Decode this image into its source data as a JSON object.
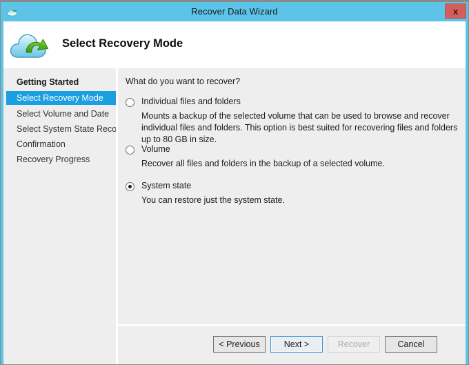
{
  "window": {
    "title": "Recover Data Wizard",
    "title_icon": "cloud-icon",
    "close_label": "x",
    "accent_color": "#5bc4e8",
    "close_color": "#d35f5c"
  },
  "header": {
    "icon": "cloud-recovery-icon",
    "page_title": "Select Recovery Mode"
  },
  "sidebar": {
    "items": [
      {
        "label": "Getting Started",
        "state": "completed"
      },
      {
        "label": "Select Recovery Mode",
        "state": "active"
      },
      {
        "label": "Select Volume and Date",
        "state": "pending"
      },
      {
        "label": "Select System State Reco...",
        "state": "pending"
      },
      {
        "label": "Confirmation",
        "state": "pending"
      },
      {
        "label": "Recovery Progress",
        "state": "pending"
      }
    ],
    "active_color": "#1a9fe0"
  },
  "main": {
    "question": "What do you want to recover?",
    "options": [
      {
        "label": "Individual files and folders",
        "description": "Mounts a backup of the selected volume that can be used to browse and recover individual files and folders. This option is best suited for recovering files and folders up to 80 GB in size.",
        "selected": false
      },
      {
        "label": "Volume",
        "description": "Recover all files and folders in the backup of a selected volume.",
        "selected": false
      },
      {
        "label": "System state",
        "description": "You can restore just the system state.",
        "selected": true
      }
    ]
  },
  "footer": {
    "buttons": [
      {
        "label": "< Previous",
        "enabled": true,
        "focused": false
      },
      {
        "label": "Next >",
        "enabled": true,
        "focused": true
      },
      {
        "label": "Recover",
        "enabled": false,
        "focused": false
      },
      {
        "label": "Cancel",
        "enabled": true,
        "focused": false
      }
    ]
  }
}
